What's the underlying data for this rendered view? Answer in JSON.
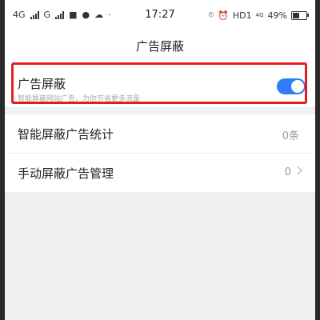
{
  "status_bar": {
    "network_left": "4G",
    "network_mid": "G",
    "time": "17:27",
    "hd_label": "HD1",
    "net_right": "4G",
    "battery": "49%",
    "battery_level": 0.49
  },
  "header": {
    "title": "广告屏蔽"
  },
  "ad_block": {
    "title": "广告屏蔽",
    "subtitle": "智能屏蔽网站广告，为你节省更多流量",
    "enabled": true
  },
  "rows": [
    {
      "label": "智能屏蔽广告统计",
      "value": "0条"
    },
    {
      "label": "手动屏蔽广告管理",
      "value": "0"
    }
  ],
  "colors": {
    "accent": "#2f7cf6",
    "highlight": "#e02020"
  }
}
